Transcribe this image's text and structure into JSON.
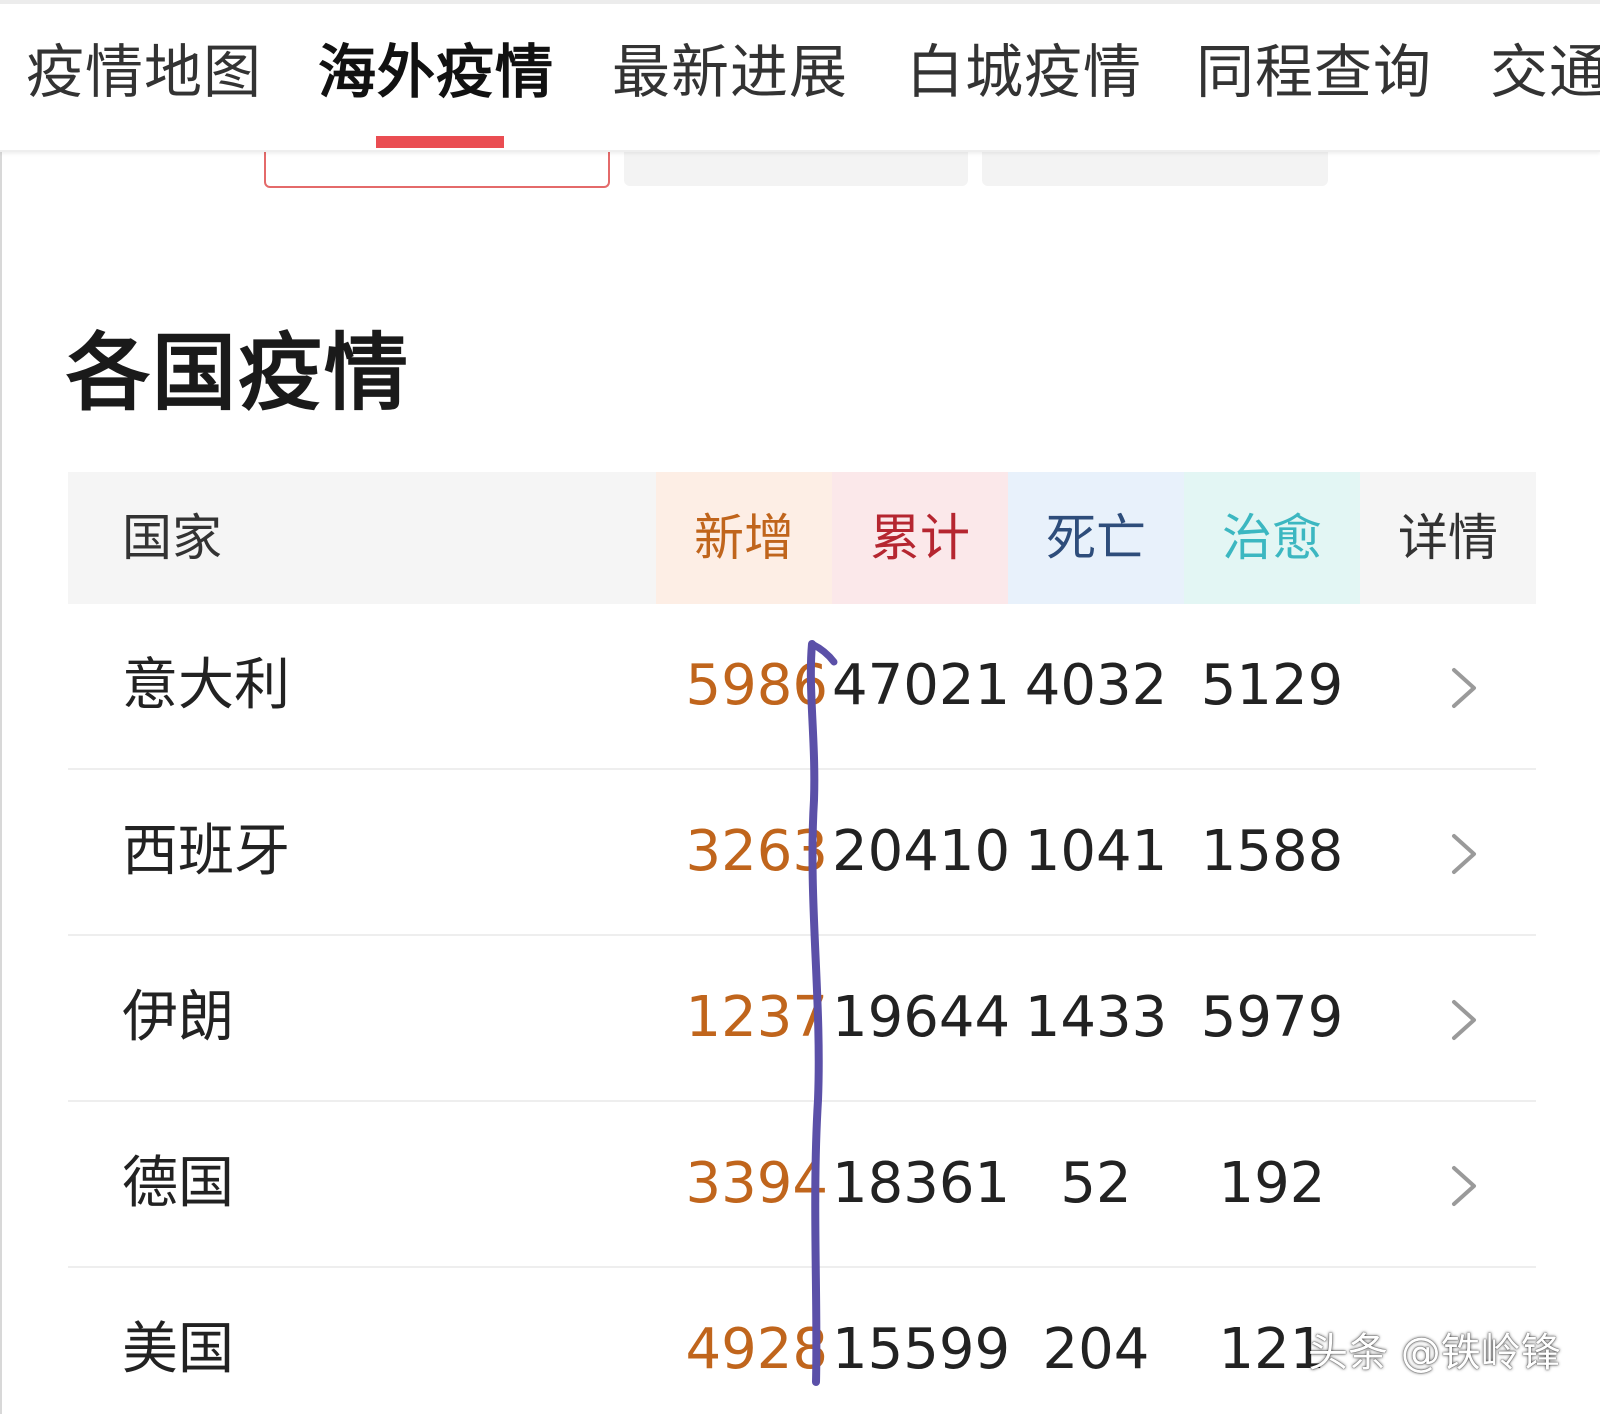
{
  "tabs": [
    {
      "label": "疫情地图",
      "active": false
    },
    {
      "label": "海外疫情",
      "active": true
    },
    {
      "label": "最新进展",
      "active": false
    },
    {
      "label": "白城疫情",
      "active": false
    },
    {
      "label": "同程查询",
      "active": false
    },
    {
      "label": "交通",
      "active": false
    }
  ],
  "section": {
    "title": "各国疫情"
  },
  "table": {
    "headers": {
      "country": "国家",
      "new": "新增",
      "total": "累计",
      "deaths": "死亡",
      "recovered": "治愈",
      "detail": "详情"
    },
    "rows": [
      {
        "country": "意大利",
        "new": "5986",
        "total": "47021",
        "deaths": "4032",
        "recovered": "5129"
      },
      {
        "country": "西班牙",
        "new": "3263",
        "total": "20410",
        "deaths": "1041",
        "recovered": "1588"
      },
      {
        "country": "伊朗",
        "new": "1237",
        "total": "19644",
        "deaths": "1433",
        "recovered": "5979"
      },
      {
        "country": "德国",
        "new": "3394",
        "total": "18361",
        "deaths": "52",
        "recovered": "192"
      },
      {
        "country": "美国",
        "new": "4928",
        "total": "15599",
        "deaths": "204",
        "recovered": "121"
      }
    ]
  },
  "icons": {
    "detail": "chevron-right-icon"
  },
  "colors": {
    "tab_indicator": "#ea4d52",
    "new": "#c0651c",
    "total": "#b52630",
    "deaths": "#2e4d7b",
    "recovered": "#3cb7c1",
    "annotation": "#5b50a8"
  },
  "watermark": "头条 @铁岭锋"
}
